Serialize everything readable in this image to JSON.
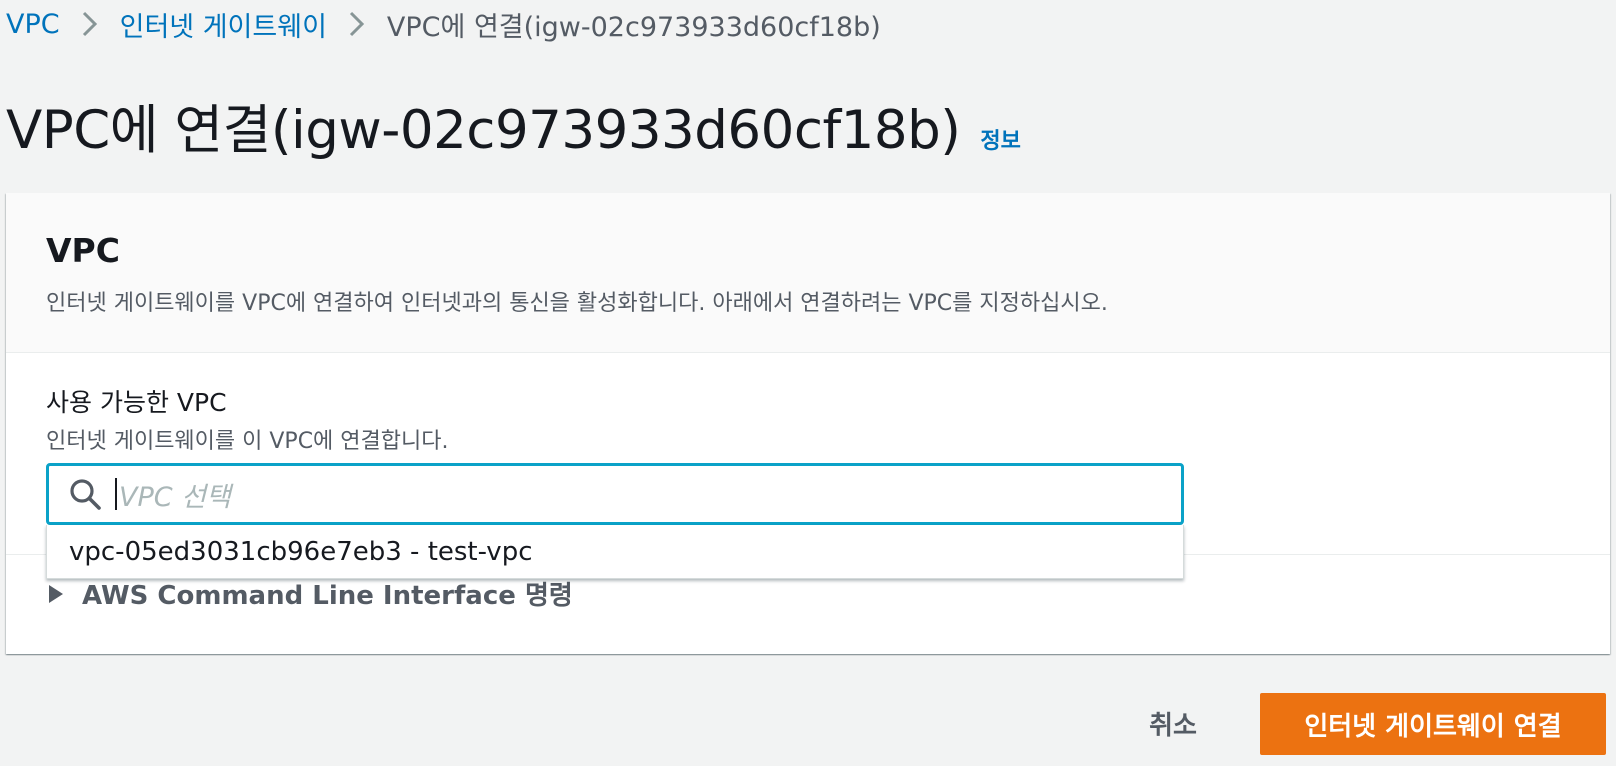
{
  "breadcrumb": {
    "items": [
      {
        "label": "VPC"
      },
      {
        "label": "인터넷 게이트웨이"
      },
      {
        "label": "VPC에 연결(igw-02c973933d60cf18b)"
      }
    ]
  },
  "header": {
    "title": "VPC에 연결(igw-02c973933d60cf18b)",
    "info_link": "정보"
  },
  "section": {
    "title": "VPC",
    "description": "인터넷 게이트웨이를 VPC에 연결하여 인터넷과의 통신을 활성화합니다. 아래에서 연결하려는 VPC를 지정하십시오."
  },
  "vpc_field": {
    "label": "사용 가능한 VPC",
    "description": "인터넷 게이트웨이를 이 VPC에 연결합니다.",
    "placeholder": "VPC 선택",
    "options": [
      "vpc-05ed3031cb96e7eb3 - test-vpc"
    ]
  },
  "cli": {
    "label": "AWS Command Line Interface 명령"
  },
  "actions": {
    "cancel_label": "취소",
    "submit_label": "인터넷 게이트웨이 연결"
  },
  "colors": {
    "link": "#0073bb",
    "focus_border": "#0aa2c8",
    "primary": "#ec7211"
  },
  "icons": [
    "chevron-right-icon",
    "search-icon",
    "caret-right-icon"
  ]
}
